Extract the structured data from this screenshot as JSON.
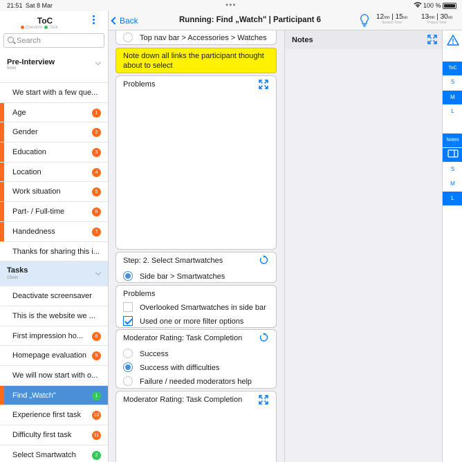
{
  "status": {
    "time": "21:51",
    "date": "Sat 8 Mar",
    "battery": "100 %"
  },
  "sidebar": {
    "title": "ToC",
    "legend": {
      "question": "Question",
      "task": "Task"
    },
    "search_placeholder": "Search",
    "pre": {
      "title": "Pre-Interview",
      "duration": "5min"
    },
    "pre_items": [
      {
        "label": "We start with a few que..."
      },
      {
        "label": "Age",
        "badge": "1"
      },
      {
        "label": "Gender",
        "badge": "2"
      },
      {
        "label": "Education",
        "badge": "3"
      },
      {
        "label": "Location",
        "badge": "4"
      },
      {
        "label": "Work situation",
        "badge": "5"
      },
      {
        "label": "Part- / Full-time",
        "badge": "6"
      },
      {
        "label": "Handedness",
        "badge": "7"
      },
      {
        "label": "Thanks for sharing this i..."
      }
    ],
    "tasks": {
      "title": "Tasks",
      "duration": "15min"
    },
    "task_items": [
      {
        "label": "Deactivate screensaver"
      },
      {
        "label": "This is the website we ..."
      },
      {
        "label": "First impression ho...",
        "badge": "8"
      },
      {
        "label": "Homepage evaluation",
        "badge": "9"
      },
      {
        "label": "We will now start with o..."
      },
      {
        "label": "Find „Watch\"",
        "badge": "1"
      },
      {
        "label": "Experience first task",
        "badge": "10"
      },
      {
        "label": "Difficulty first task",
        "badge": "11"
      },
      {
        "label": "Select Smartwatch",
        "badge": "2"
      }
    ],
    "colors": {
      "orange": "#ff6b1a",
      "green": "#34c759",
      "selected": "#4a90d9"
    }
  },
  "nav": {
    "back": "Back",
    "title": "Running: Find „Watch\" | Participant 6",
    "timers": [
      {
        "min": "12",
        "sec": "15",
        "caption": "Section Time"
      },
      {
        "min": "13",
        "sec": "30",
        "caption": "Project Time"
      }
    ],
    "unit_min": "mn",
    "unit_sec": "sn"
  },
  "content": {
    "prev_option": "Top nav bar > Accessories > Watches",
    "highlight_note": "Note down all links the participant thought about to select",
    "problems1_title": "Problems",
    "step_title": "Step: 2. Select Smartwatches",
    "step_option": "Side bar > Smartwatches",
    "problems2_title": "Problems",
    "problems2_items": [
      {
        "label": "Overlooked Smartwatches in side bar",
        "checked": false
      },
      {
        "label": "Used one or more filter options",
        "checked": true
      }
    ],
    "rating_title": "Moderator Rating: Task Completion",
    "rating_options": [
      {
        "label": "Success",
        "selected": false
      },
      {
        "label": "Success with difficulties",
        "selected": true
      },
      {
        "label": "Failure / needed moderators help",
        "selected": false
      }
    ],
    "rating2_title": "Moderator Rating: Task Completion"
  },
  "notes": {
    "title": "Notes"
  },
  "rail": {
    "toc": "ToC",
    "toc_sizes": [
      "S",
      "M",
      "L"
    ],
    "notes": "Notes",
    "notes_sizes": [
      "S",
      "M",
      "L"
    ]
  }
}
